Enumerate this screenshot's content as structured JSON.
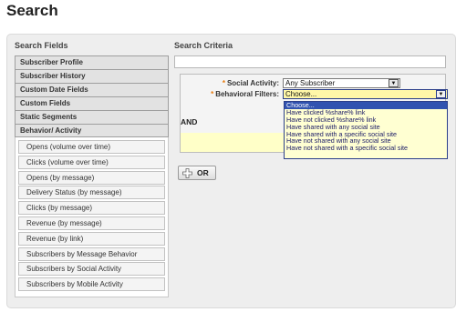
{
  "page_title": "Search",
  "search_fields": {
    "title": "Search Fields",
    "categories": [
      {
        "label": "Subscriber Profile"
      },
      {
        "label": "Subscriber History"
      },
      {
        "label": "Custom Date Fields"
      },
      {
        "label": "Custom Fields"
      },
      {
        "label": "Static Segments"
      },
      {
        "label": "Behavior/ Activity"
      }
    ],
    "behavior_items": [
      {
        "label": "Opens (volume over time)"
      },
      {
        "label": "Clicks (volume over time)"
      },
      {
        "label": "Opens (by message)"
      },
      {
        "label": "Delivery Status (by message)"
      },
      {
        "label": "Clicks (by message)"
      },
      {
        "label": "Revenue (by message)"
      },
      {
        "label": "Revenue (by link)"
      },
      {
        "label": "Subscribers by Message Behavior"
      },
      {
        "label": "Subscribers by Social Activity"
      },
      {
        "label": "Subscribers by Mobile Activity"
      }
    ]
  },
  "search_criteria": {
    "title": "Search Criteria",
    "required_marker": "*",
    "social_activity": {
      "label": "Social Activity:",
      "value": "Any Subscriber"
    },
    "behavioral_filters": {
      "label": "Behavioral Filters:",
      "value": "Choose...",
      "options": [
        {
          "label": "Choose..."
        },
        {
          "label": "Have clicked %share% link"
        },
        {
          "label": "Have not clicked %share% link"
        },
        {
          "label": "Have shared with any social site"
        },
        {
          "label": "Have shared with a specific social site"
        },
        {
          "label": "Have not shared with any social site"
        },
        {
          "label": "Have not shared with a specific social site"
        }
      ]
    },
    "and_label": "AND",
    "or_button": "OR"
  },
  "colors": {
    "required": "#e87a0c",
    "highlight": "#3153b0",
    "dropdown_bg": "#ffffd2",
    "strip": "#ffffc8"
  }
}
